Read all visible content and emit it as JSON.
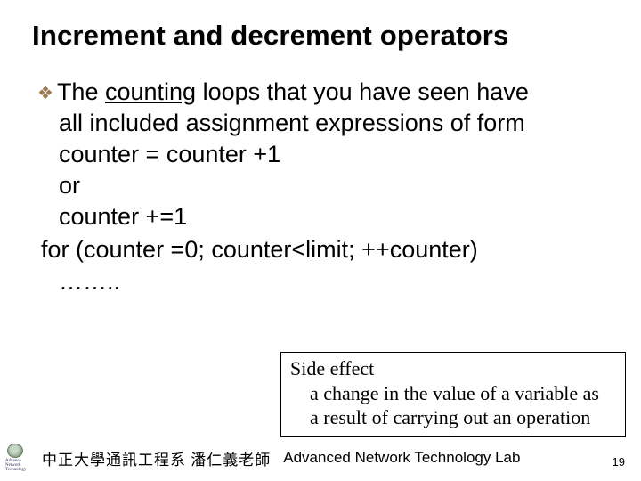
{
  "title": "Increment and decrement operators",
  "bullet": {
    "line1_part1": "The ",
    "line1_counting": "counting",
    "line1_part2": " loops that you have seen have",
    "line2": "all included assignment expressions of form",
    "line3": "counter =  counter +1",
    "line4": "or",
    "line5": "counter +=1"
  },
  "for_line": "for (counter =0; counter<limit; ++counter)",
  "dots": "……..",
  "callout": {
    "heading": "Side effect",
    "body_l1": "a change in the value of a variable as",
    "body_l2": "a result of carrying out an operation"
  },
  "footer": {
    "cn": "中正大學通訊工程系 潘仁義老師",
    "en": "Advanced Network Technology Lab",
    "page": "19"
  },
  "logo_lines": [
    "Advance",
    "Network",
    "Technology"
  ]
}
